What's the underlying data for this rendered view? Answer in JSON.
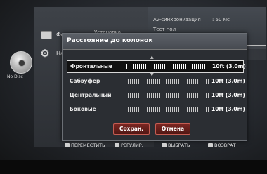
{
  "left_menu": {
    "item1": "Фото",
    "item2": "На"
  },
  "settings_menu": {
    "header1": "Установка",
    "av_sync_label": "AV-синхронизация",
    "av_sync_value": ": 50 мс",
    "partial_line": "Тест пол"
  },
  "disc_label": "No Disc",
  "dialog": {
    "title": "Расстояние до колонок",
    "rows": [
      {
        "label": "Фронтальные",
        "value": "10ft (3.0m)"
      },
      {
        "label": "Сабвуфер",
        "value": "10ft (3.0m)"
      },
      {
        "label": "Центральный",
        "value": "10ft (3.0m)"
      },
      {
        "label": "Боковые",
        "value": "10ft (3.0m)"
      }
    ],
    "save_button": "Сохран.",
    "cancel_button": "Отмена"
  },
  "footer": {
    "move": "ПЕРЕМЕСТИТЬ",
    "adjust": "РЕГУЛИР.",
    "select": "ВЫБРАТЬ",
    "back": "ВОЗВРАТ"
  }
}
